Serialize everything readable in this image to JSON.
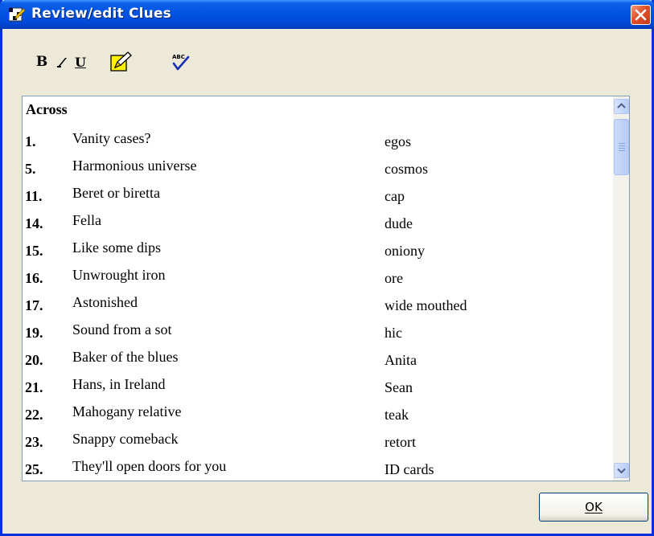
{
  "window": {
    "title": "Review/edit Clues",
    "icons": {
      "title": "crossword-grid-icon",
      "close": "close-icon"
    }
  },
  "toolbar": {
    "bold_label": "B",
    "italic_icon": "italic-icon",
    "underline_label": "U",
    "edit_icon": "pencil-edit-icon",
    "spellcheck_icon": "spellcheck-icon"
  },
  "clues": {
    "heading": "Across",
    "items": [
      {
        "num": "1.",
        "clue": "Vanity cases?",
        "answer": "egos"
      },
      {
        "num": "5.",
        "clue": "Harmonious universe",
        "answer": "cosmos"
      },
      {
        "num": "11.",
        "clue": "Beret or biretta",
        "answer": "cap"
      },
      {
        "num": "14.",
        "clue": "Fella",
        "answer": "dude"
      },
      {
        "num": "15.",
        "clue": "Like some dips",
        "answer": "oniony"
      },
      {
        "num": "16.",
        "clue": "Unwrought iron",
        "answer": "ore"
      },
      {
        "num": "17.",
        "clue": "Astonished",
        "answer": "wide mouthed"
      },
      {
        "num": "19.",
        "clue": "Sound from a sot",
        "answer": "hic"
      },
      {
        "num": "20.",
        "clue": "Baker of the blues",
        "answer": "Anita"
      },
      {
        "num": "21.",
        "clue": "Hans, in Ireland",
        "answer": "Sean"
      },
      {
        "num": "22.",
        "clue": "Mahogany relative",
        "answer": "teak"
      },
      {
        "num": "23.",
        "clue": "Snappy comeback",
        "answer": "retort"
      },
      {
        "num": "25.",
        "clue": "They'll open doors for you",
        "answer": "ID cards"
      }
    ]
  },
  "buttons": {
    "ok_label": "OK"
  },
  "colors": {
    "title_bar": "#0054e3",
    "close_button": "#e2502a",
    "dialog_bg": "#ece9d8"
  }
}
